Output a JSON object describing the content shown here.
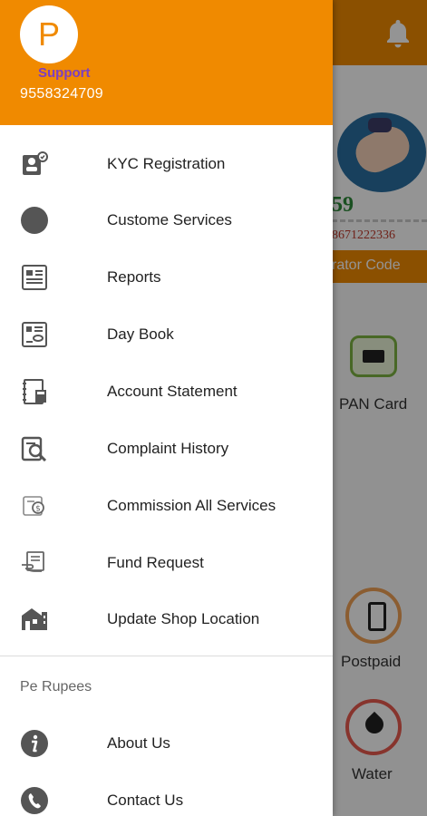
{
  "drawer": {
    "header": {
      "avatar_letter": "P",
      "user_name": "Support",
      "phone": "9558324709"
    },
    "menu": [
      {
        "label": "KYC Registration",
        "icon": "kyc-id-icon"
      },
      {
        "label": "Custome Services",
        "icon": "circle-icon"
      },
      {
        "label": "Reports",
        "icon": "report-icon"
      },
      {
        "label": "Day Book",
        "icon": "day-book-icon"
      },
      {
        "label": "Account Statement",
        "icon": "statement-icon"
      },
      {
        "label": "Complaint History",
        "icon": "complaint-icon"
      },
      {
        "label": "Commission All Services",
        "icon": "commission-icon"
      },
      {
        "label": "Fund Request",
        "icon": "fund-request-icon"
      },
      {
        "label": "Update Shop Location",
        "icon": "shop-location-icon"
      }
    ],
    "section_title": "Pe Rupees",
    "secondary_menu": [
      {
        "label": "About Us",
        "icon": "info-icon"
      },
      {
        "label": "Contact Us",
        "icon": "phone-icon"
      }
    ]
  },
  "background": {
    "banner_green_text": "59",
    "banner_red_text": "8671222336",
    "operator_text": "rator Code",
    "services": [
      {
        "label": "PAN Card",
        "icon": "pan-card-icon"
      },
      {
        "label": "Postpaid",
        "icon": "postpaid-icon"
      },
      {
        "label": "Water",
        "icon": "water-icon"
      }
    ]
  },
  "colors": {
    "accent": "#f08a00",
    "user_name": "#7b3fc4",
    "icon_gray": "#555555"
  }
}
